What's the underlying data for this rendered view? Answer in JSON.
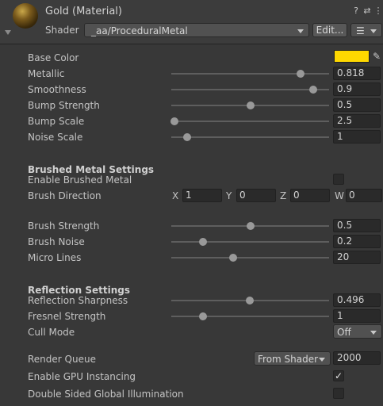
{
  "header": {
    "title": "Gold (Material)",
    "shader_label": "Shader",
    "shader_value": "_aa/ProceduralMetal",
    "edit_button": "Edit...",
    "list_icon": "☰",
    "help_icon": "?",
    "settings_icon": "⇄",
    "more_icon": "⋮"
  },
  "properties": {
    "base_color": {
      "label": "Base Color",
      "color": "#ffd800"
    },
    "metallic": {
      "label": "Metallic",
      "value": "0.818",
      "level": 0.818
    },
    "smoothness": {
      "label": "Smoothness",
      "value": "0.9",
      "level": 0.9
    },
    "bump_strength": {
      "label": "Bump Strength",
      "value": "0.5",
      "level": 0.5
    },
    "bump_scale": {
      "label": "Bump Scale",
      "value": "2.5",
      "level": 0.02
    },
    "noise_scale": {
      "label": "Noise Scale",
      "value": "1",
      "level": 0.1
    }
  },
  "brushed": {
    "heading": "Brushed Metal Settings",
    "enable_label": "Enable Brushed Metal",
    "direction_label": "Brush Direction",
    "x_label": "X",
    "x": "1",
    "y_label": "Y",
    "y": "0",
    "z_label": "Z",
    "z": "0",
    "w_label": "W",
    "w": "0",
    "brush_strength": {
      "label": "Brush Strength",
      "value": "0.5",
      "level": 0.5
    },
    "brush_noise": {
      "label": "Brush Noise",
      "value": "0.2",
      "level": 0.2
    },
    "micro_lines": {
      "label": "Micro Lines",
      "value": "20",
      "level": 0.39
    }
  },
  "reflection": {
    "heading": "Reflection Settings",
    "sharpness": {
      "label": "Reflection Sharpness",
      "value": "0.496",
      "level": 0.496
    },
    "fresnel": {
      "label": "Fresnel Strength",
      "value": "1",
      "level": 0.2
    },
    "cull_mode_label": "Cull Mode",
    "cull_mode_value": "Off"
  },
  "advanced": {
    "render_queue_label": "Render Queue",
    "render_queue_mode": "From Shader",
    "render_queue_value": "2000",
    "gpu_instancing_label": "Enable GPU Instancing",
    "gpu_instancing_check": "✓",
    "double_sided_label": "Double Sided Global Illumination"
  }
}
